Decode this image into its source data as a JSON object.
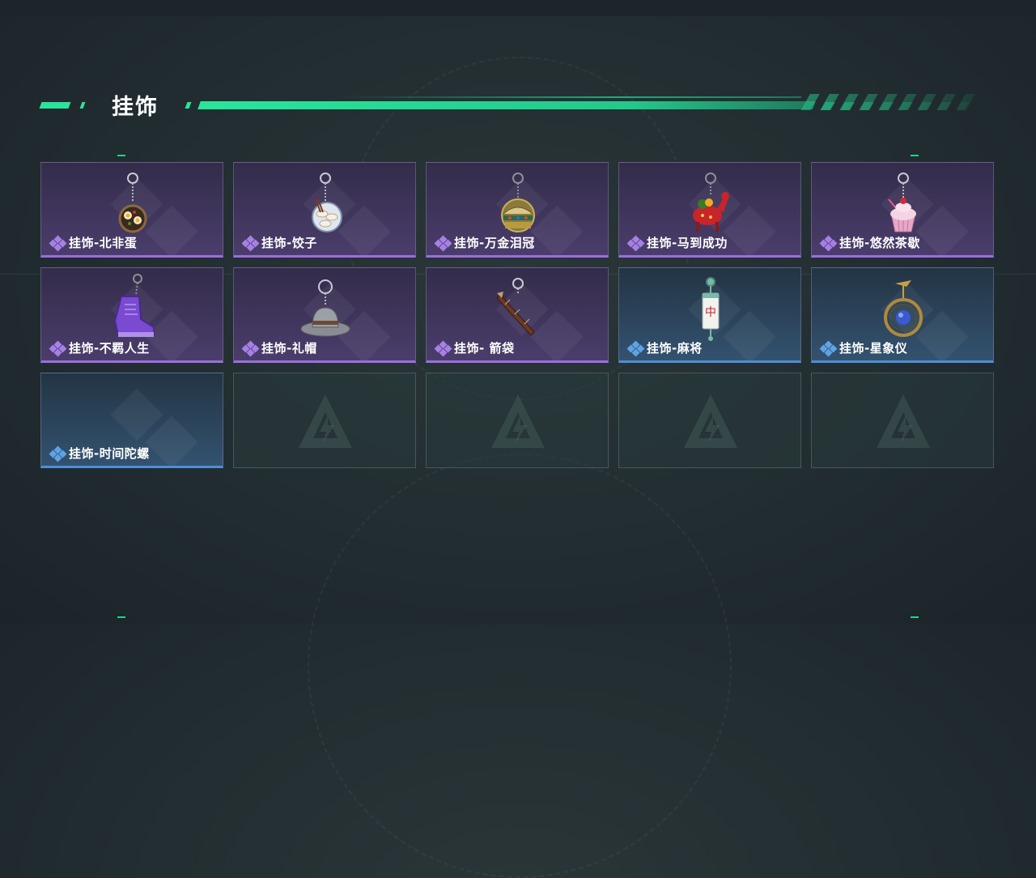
{
  "section": {
    "title": "挂饰"
  },
  "items": [
    {
      "label": "挂饰-北非蛋",
      "rarity": "purple",
      "icon": "shakshuka-charm-icon"
    },
    {
      "label": "挂饰-饺子",
      "rarity": "purple",
      "icon": "dumpling-charm-icon"
    },
    {
      "label": "挂饰-万金泪冠",
      "rarity": "purple",
      "icon": "jeweled-crown-charm-icon"
    },
    {
      "label": "挂饰-马到成功",
      "rarity": "purple",
      "icon": "red-horse-charm-icon"
    },
    {
      "label": "挂饰-悠然茶歇",
      "rarity": "purple",
      "icon": "cupcake-charm-icon"
    },
    {
      "label": "挂饰-不羁人生",
      "rarity": "purple",
      "icon": "sneaker-charm-icon"
    },
    {
      "label": "挂饰-礼帽",
      "rarity": "purple",
      "icon": "fedora-charm-icon"
    },
    {
      "label": "挂饰- 箭袋",
      "rarity": "purple",
      "icon": "quiver-charm-icon"
    },
    {
      "label": "挂饰-麻将",
      "rarity": "blue",
      "icon": "mahjong-tile-charm-icon"
    },
    {
      "label": "挂饰-星象仪",
      "rarity": "blue",
      "icon": "astrolabe-charm-icon"
    },
    {
      "label": "挂饰-时间陀螺",
      "rarity": "blue",
      "icon": ""
    },
    {
      "label": "",
      "rarity": "empty",
      "icon": "placeholder-logo-icon"
    },
    {
      "label": "",
      "rarity": "empty",
      "icon": "placeholder-logo-icon"
    },
    {
      "label": "",
      "rarity": "empty",
      "icon": "placeholder-logo-icon"
    },
    {
      "label": "",
      "rarity": "empty",
      "icon": "placeholder-logo-icon"
    }
  ],
  "colors": {
    "accent": "#2be39a",
    "purple_rarity": "#9b6ee0",
    "blue_rarity": "#4c8fd6"
  }
}
